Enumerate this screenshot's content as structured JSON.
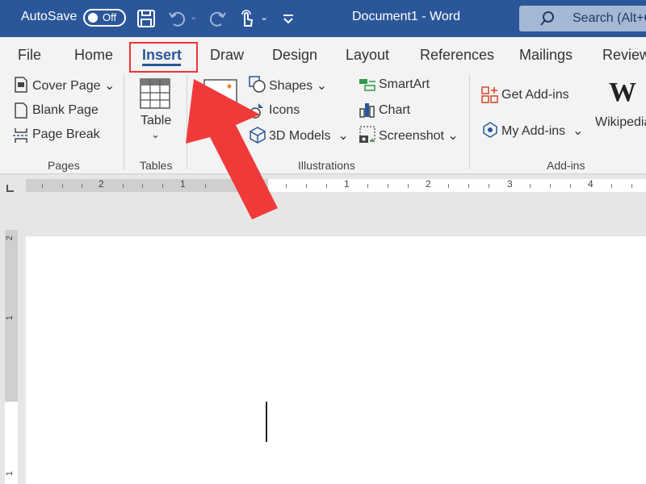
{
  "titlebar": {
    "autosave_label": "AutoSave",
    "autosave_state": "Off",
    "document_title": "Document1  -  Word",
    "search_placeholder": "Search (Alt+Q)"
  },
  "tabs": [
    {
      "label": "File"
    },
    {
      "label": "Home"
    },
    {
      "label": "Insert",
      "active": true
    },
    {
      "label": "Draw"
    },
    {
      "label": "Design"
    },
    {
      "label": "Layout"
    },
    {
      "label": "References"
    },
    {
      "label": "Mailings"
    },
    {
      "label": "Review"
    }
  ],
  "ribbon": {
    "pages": {
      "cover_page": "Cover Page",
      "blank_page": "Blank Page",
      "page_break": "Page Break",
      "label": "Pages"
    },
    "tables": {
      "table": "Table",
      "label": "Tables"
    },
    "illustrations": {
      "shapes": "Shapes",
      "icons": "Icons",
      "models": "3D Models",
      "smartart": "SmartArt",
      "chart": "Chart",
      "screenshot": "Screenshot",
      "label": "Illustrations"
    },
    "addins": {
      "get": "Get Add-ins",
      "my": "My Add-ins",
      "wikipedia": "Wikipedia",
      "label": "Add-ins"
    }
  },
  "ruler": {
    "labels": [
      "2",
      "1",
      "1",
      "2",
      "3",
      "4"
    ],
    "vertical_labels": [
      "2",
      "1",
      "1"
    ]
  },
  "colors": {
    "brand": "#2b579a",
    "highlight": "#e33333",
    "arrow": "#f03a3a"
  },
  "icons": [
    "save-icon",
    "undo-icon",
    "redo-icon",
    "touch-mode-icon",
    "customize-qat-icon",
    "search-icon",
    "table-icon",
    "shapes-icon",
    "icons-icon",
    "3d-models-icon",
    "smartart-icon",
    "chart-icon",
    "screenshot-icon",
    "get-addins-icon",
    "my-addins-icon",
    "wikipedia-icon",
    "annotation-arrow"
  ]
}
